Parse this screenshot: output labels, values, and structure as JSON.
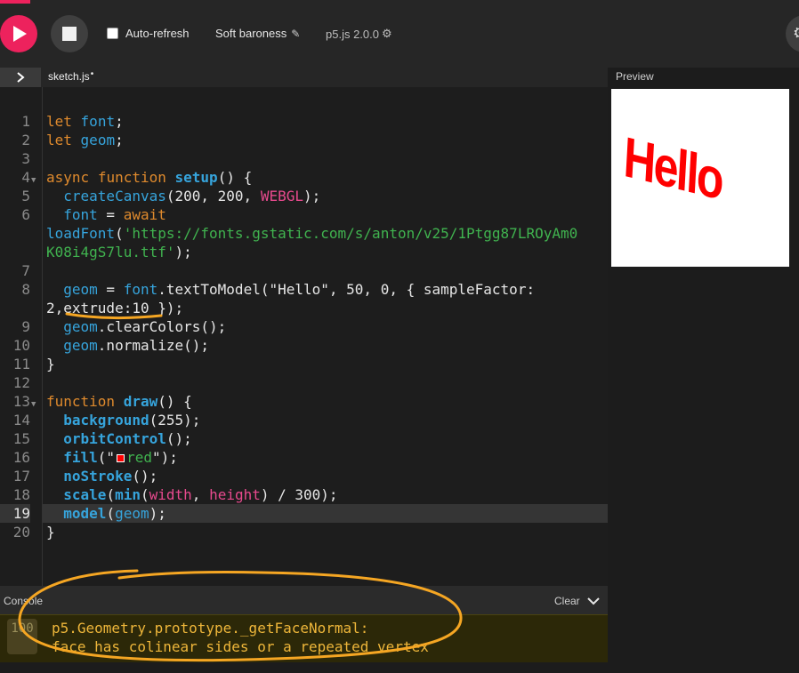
{
  "toolbar": {
    "play_label": "Play",
    "stop_label": "Stop",
    "auto_refresh_label": "Auto-refresh",
    "auto_refresh_checked": false,
    "sketch_name": "Soft baroness",
    "version_label": "p5.js 2.0.0"
  },
  "editor": {
    "file_tab": "sketch.js",
    "unsaved_marker": "•",
    "active_line": 19
  },
  "preview": {
    "label": "Preview",
    "rendered_text": "Hello",
    "canvas_bg": "#ffffff",
    "fill_color": "#ff0000"
  },
  "console": {
    "title": "Console",
    "clear_label": "Clear",
    "count": "100",
    "message_line1": "p5.Geometry.prototype._getFaceNormal:",
    "message_line2": "face has colinear sides or a repeated vertex"
  },
  "code": {
    "l1_kw": "let",
    "l1_var": "font",
    "l1_end": ";",
    "l2_kw": "let",
    "l2_var": "geom",
    "l2_end": ";",
    "l4_kw1": "async",
    "l4_kw2": "function",
    "l4_fn": "setup",
    "l4_rest": "() {",
    "l5_fn": "createCanvas",
    "l5_a": "(200, 200, ",
    "l5_const": "WEBGL",
    "l5_b": ");",
    "l6_var": "font",
    "l6_a": " = ",
    "l6_kw": "await",
    "l6_fn": "loadFont",
    "l6_p1": "(",
    "l6_str1": "'https://fonts.gstatic.com/s/anton/v25/1Ptgg87LROyAm0",
    "l6_str2": "K08i4gS7lu.ttf'",
    "l6_p2": ");",
    "l8_var": "geom",
    "l8_a": " = ",
    "l8_var2": "font",
    "l8_b": ".textToModel(\"Hello\", 50, 0, { sampleFactor:",
    "l8_wrap": "2,extrude:10 });",
    "l9_var": "geom",
    "l9_rest": ".clearColors();",
    "l10_var": "geom",
    "l10_rest": ".normalize();",
    "l11": "}",
    "l13_kw": "function",
    "l13_fn": "draw",
    "l13_rest": "() {",
    "l14_fn": "background",
    "l14_rest": "(255);",
    "l15_fn": "orbitControl",
    "l15_rest": "();",
    "l16_fn": "fill",
    "l16_a": "(\"",
    "l16_str": "red",
    "l16_b": "\");",
    "l17_fn": "noStroke",
    "l17_rest": "();",
    "l18_fn": "scale",
    "l18_a": "(",
    "l18_fn2": "min",
    "l18_b": "(",
    "l18_c1": "width",
    "l18_c": ", ",
    "l18_c2": "height",
    "l18_d": ") / 300);",
    "l19_fn": "model",
    "l19_a": "(",
    "l19_var": "geom",
    "l19_b": ");",
    "l20": "}"
  },
  "line_numbers": [
    "1",
    "2",
    "3",
    "4",
    "5",
    "6",
    "7",
    "8",
    "9",
    "10",
    "11",
    "12",
    "13",
    "14",
    "15",
    "16",
    "17",
    "18",
    "19",
    "20"
  ],
  "colors": {
    "accent": "#ed225d",
    "keyword": "#df8a2d",
    "variable": "#36a4dc",
    "constant": "#e84a8e",
    "string": "#40b34f",
    "warning_text": "#eeb63a",
    "annotation": "#f5a623"
  }
}
